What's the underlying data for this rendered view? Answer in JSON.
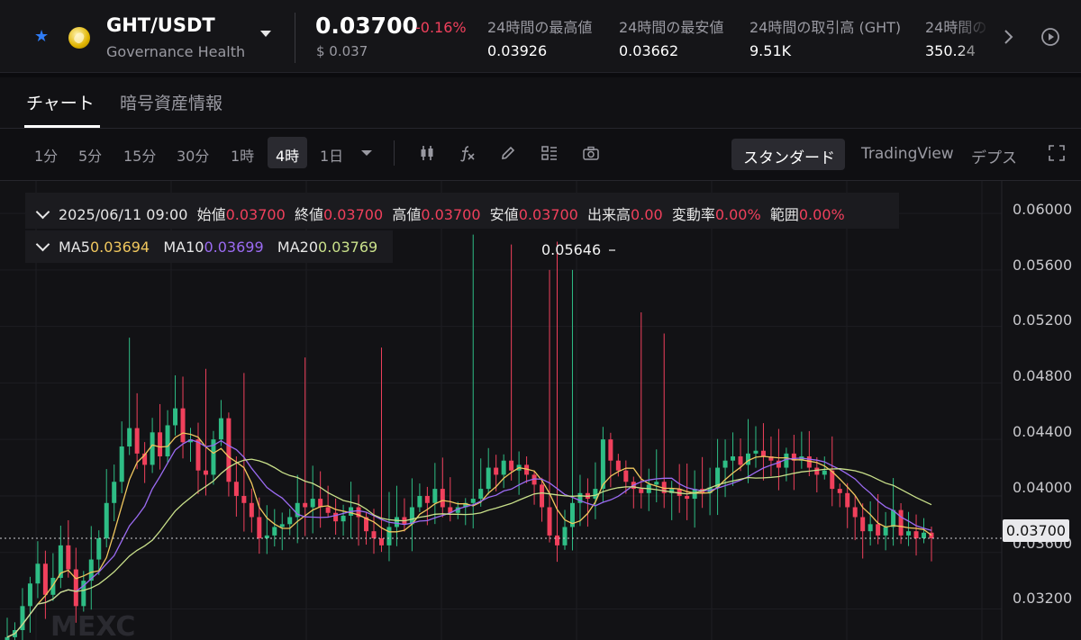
{
  "header": {
    "pair": "GHT/USDT",
    "pair_name": "Governance Health",
    "price": "0.03700",
    "change": "-0.16%",
    "usd_price": "$ 0.037",
    "stats": [
      {
        "label": "24時間の最高値",
        "value": "0.03926"
      },
      {
        "label": "24時間の最安値",
        "value": "0.03662"
      },
      {
        "label": "24時間の取引高 (GHT)",
        "value": "9.51K"
      },
      {
        "label": "24時間の",
        "value": "350.24"
      }
    ]
  },
  "tabs": [
    {
      "label": "チャート"
    },
    {
      "label": "暗号資産情報"
    }
  ],
  "toolbar": {
    "timeframes": [
      "1分",
      "5分",
      "15分",
      "30分",
      "1時",
      "4時",
      "1日"
    ],
    "active_timeframe": "4時",
    "views": [
      "スタンダード",
      "TradingView",
      "デプス"
    ],
    "active_view": "スタンダード"
  },
  "ohlc": {
    "datetime": "2025/06/11 09:00",
    "open_label": "始値",
    "open": "0.03700",
    "close_label": "終値",
    "close": "0.03700",
    "high_label": "高値",
    "high": "0.03700",
    "low_label": "安値",
    "low": "0.03700",
    "volume_label": "出来高",
    "volume": "0.00",
    "change_label": "変動率",
    "change": "0.00%",
    "range_label": "範囲",
    "range": "0.00%"
  },
  "ma": {
    "ma5_label": "MA5",
    "ma5": "0.03694",
    "ma10_label": "MA10",
    "ma10": "0.03699",
    "ma20_label": "MA20",
    "ma20": "0.03769"
  },
  "colors": {
    "up": "#2ebd85",
    "down": "#f0405c",
    "ma5": "#f0c75e",
    "ma10": "#9b6bf2",
    "ma20": "#c9e08a"
  },
  "chart_data": {
    "type": "candlestick",
    "y_ticks": [
      "0.06000",
      "0.05600",
      "0.05200",
      "0.04800",
      "0.04400",
      "0.04000",
      "0.03600",
      "0.03200"
    ],
    "ylim": [
      0.0298,
      0.0623
    ],
    "current_price": "0.03700",
    "max_marker": "0.05646",
    "watermark": "MEXC",
    "closes": [
      0.03,
      0.0305,
      0.0322,
      0.0338,
      0.0352,
      0.033,
      0.0342,
      0.0365,
      0.0348,
      0.0322,
      0.034,
      0.0355,
      0.037,
      0.0395,
      0.041,
      0.0435,
      0.0448,
      0.043,
      0.0422,
      0.0445,
      0.0428,
      0.045,
      0.0462,
      0.0438,
      0.044,
      0.0418,
      0.0415,
      0.044,
      0.0455,
      0.041,
      0.04,
      0.0395,
      0.0385,
      0.037,
      0.0372,
      0.0378,
      0.038,
      0.0385,
      0.0395,
      0.0392,
      0.0398,
      0.0392,
      0.0388,
      0.0382,
      0.0386,
      0.0392,
      0.0385,
      0.0375,
      0.037,
      0.0365,
      0.0378,
      0.0385,
      0.038,
      0.0392,
      0.04,
      0.0395,
      0.0405,
      0.0392,
      0.0388,
      0.0392,
      0.0395,
      0.0398,
      0.0405,
      0.042,
      0.0415,
      0.0425,
      0.0418,
      0.0422,
      0.0415,
      0.0408,
      0.0392,
      0.0372,
      0.0365,
      0.0378,
      0.0395,
      0.0402,
      0.0398,
      0.0405,
      0.044,
      0.0425,
      0.0418,
      0.041,
      0.0405,
      0.0402,
      0.0408,
      0.041,
      0.0402,
      0.0405,
      0.04,
      0.0398,
      0.0405,
      0.0402,
      0.0406,
      0.042,
      0.0425,
      0.0428,
      0.0422,
      0.043,
      0.0432,
      0.0428,
      0.0425,
      0.042,
      0.043,
      0.0425,
      0.0428,
      0.042,
      0.0415,
      0.0418,
      0.0405,
      0.0402,
      0.0392,
      0.0385,
      0.0375,
      0.038,
      0.0372,
      0.0378,
      0.039,
      0.0372,
      0.0375,
      0.037,
      0.0374,
      0.037
    ]
  }
}
